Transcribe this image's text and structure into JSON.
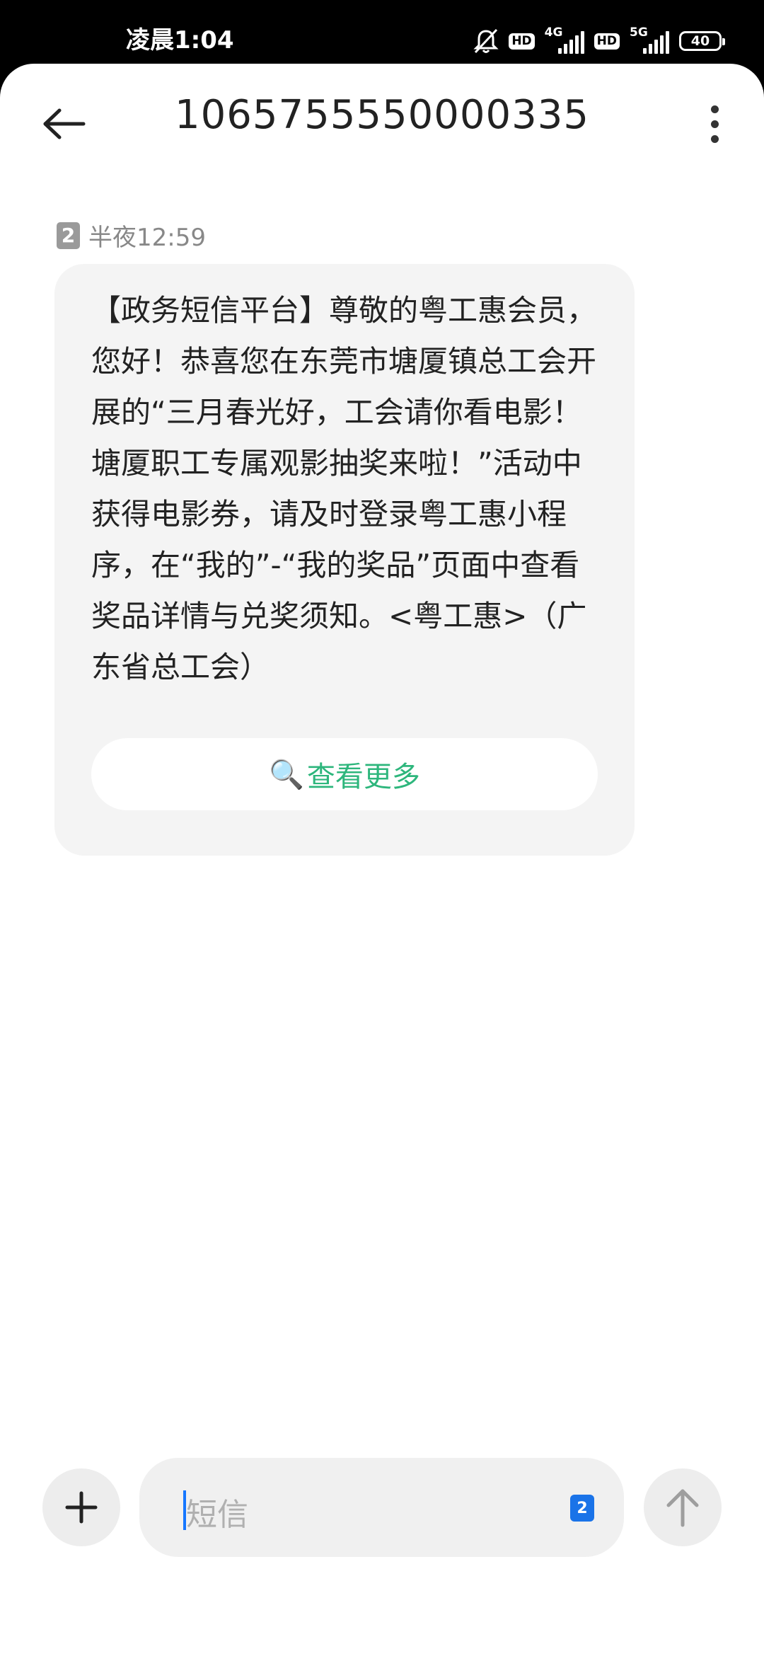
{
  "status_bar": {
    "time": "凌晨1:04",
    "hd_label": "HD",
    "network_1": "4G",
    "network_2": "5G",
    "battery": "40"
  },
  "header": {
    "back_icon": "arrow-left-icon",
    "title": "1065755550000335",
    "menu_icon": "more-vertical-icon"
  },
  "message": {
    "sim": "2",
    "time": "半夜12:59",
    "text": "【政务短信平台】尊敬的粤工惠会员，您好！恭喜您在东莞市塘厦镇总工会开展的“三月春光好，工会请你看电影！塘厦职工专属观影抽奖来啦！”活动中获得电影券，请及时登录粤工惠小程序，在“我的”-“我的奖品”页面中查看奖品详情与兑奖须知。<粤工惠>（广东省总工会）",
    "action_icon": "🔍",
    "action_label": "查看更多"
  },
  "composer": {
    "add_icon": "plus-icon",
    "placeholder": "短信",
    "sim": "2",
    "send_icon": "arrow-up-icon"
  },
  "colors": {
    "accent_green": "#2db67c",
    "sim_blue": "#1a73e8"
  }
}
